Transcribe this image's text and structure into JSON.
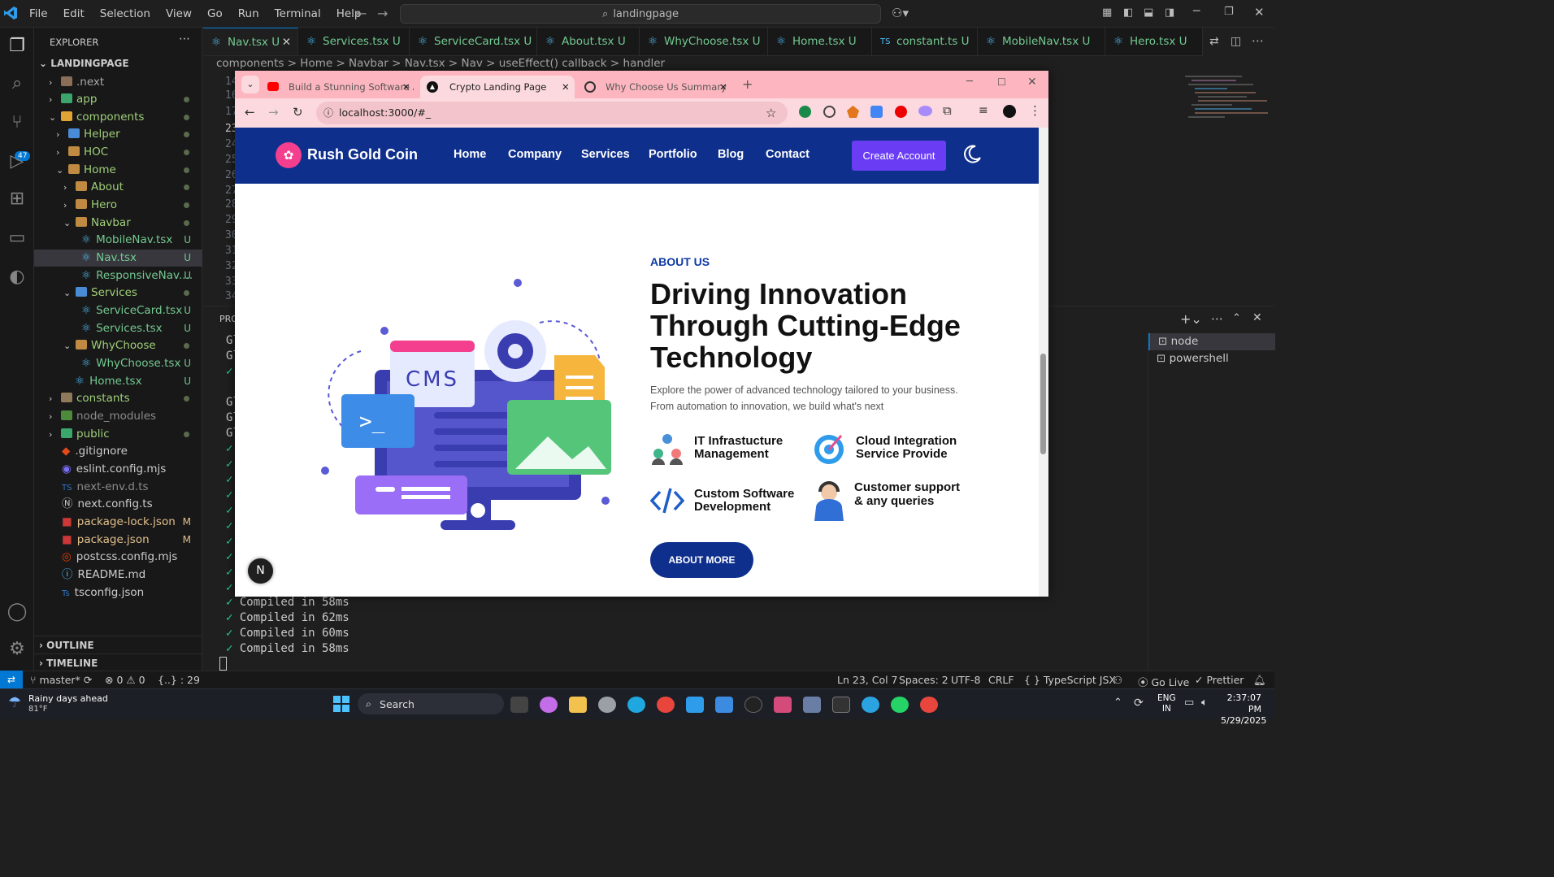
{
  "menu": [
    "File",
    "Edit",
    "Selection",
    "View",
    "Go",
    "Run",
    "Terminal",
    "Help"
  ],
  "search": {
    "label": "landingpage"
  },
  "explorer": {
    "title": "EXPLORER",
    "root": "LANDINGPAGE",
    "items": [
      {
        "label": ".next",
        "status": ""
      },
      {
        "label": "app",
        "status": ""
      },
      {
        "label": "components",
        "status": ""
      },
      {
        "label": "Helper",
        "status": ""
      },
      {
        "label": "HOC",
        "status": ""
      },
      {
        "label": "Home",
        "status": ""
      },
      {
        "label": "About",
        "status": ""
      },
      {
        "label": "Hero",
        "status": ""
      },
      {
        "label": "Navbar",
        "status": ""
      },
      {
        "label": "MobileNav.tsx",
        "status": "U"
      },
      {
        "label": "Nav.tsx",
        "status": "U"
      },
      {
        "label": "ResponsiveNav....",
        "status": "U"
      },
      {
        "label": "Services",
        "status": ""
      },
      {
        "label": "ServiceCard.tsx",
        "status": "U"
      },
      {
        "label": "Services.tsx",
        "status": "U"
      },
      {
        "label": "WhyChoose",
        "status": ""
      },
      {
        "label": "WhyChoose.tsx",
        "status": "U"
      },
      {
        "label": "Home.tsx",
        "status": "U"
      },
      {
        "label": "constants",
        "status": ""
      },
      {
        "label": "node_modules",
        "status": ""
      },
      {
        "label": "public",
        "status": ""
      },
      {
        "label": ".gitignore",
        "status": ""
      },
      {
        "label": "eslint.config.mjs",
        "status": ""
      },
      {
        "label": "next-env.d.ts",
        "status": ""
      },
      {
        "label": "next.config.ts",
        "status": ""
      },
      {
        "label": "package-lock.json",
        "status": "M"
      },
      {
        "label": "package.json",
        "status": "M"
      },
      {
        "label": "postcss.config.mjs",
        "status": ""
      },
      {
        "label": "README.md",
        "status": ""
      },
      {
        "label": "tsconfig.json",
        "status": ""
      }
    ],
    "outline": "OUTLINE",
    "timeline": "TIMELINE"
  },
  "tabs": [
    {
      "label": "Nav.tsx",
      "status": "U"
    },
    {
      "label": "Services.tsx",
      "status": "U"
    },
    {
      "label": "ServiceCard.tsx",
      "status": "U"
    },
    {
      "label": "About.tsx",
      "status": "U"
    },
    {
      "label": "WhyChoose.tsx",
      "status": "U"
    },
    {
      "label": "Home.tsx",
      "status": "U"
    },
    {
      "label": "constant.ts",
      "status": "U"
    },
    {
      "label": "MobileNav.tsx",
      "status": "U"
    },
    {
      "label": "Hero.tsx",
      "status": "U"
    }
  ],
  "breadcrumbs": "components > Home > Navbar > Nav.tsx > Nav > useEffect() callback > handler",
  "gutter": [
    "14",
    "16",
    "17",
    "23",
    "24",
    "25",
    "26",
    "27",
    "28",
    "29",
    "30",
    "31",
    "32",
    "33",
    "34"
  ],
  "terminal": {
    "panel_label": "PRO",
    "lines": [
      "Compiled in 58ms",
      "Compiled in 62ms",
      "Compiled in 60ms",
      "Compiled in 58ms"
    ],
    "prefix": "Gl",
    "shells": [
      "node",
      "powershell"
    ]
  },
  "browser": {
    "tabs": [
      "Build a Stunning Software Agen",
      "Crypto Landing Page",
      "Why Choose Us Summary"
    ],
    "url": "localhost:3000/#_"
  },
  "site": {
    "brand": "Rush Gold Coin",
    "nav": [
      "Home",
      "Company",
      "Services",
      "Portfolio",
      "Blog",
      "Contact"
    ],
    "cta": "Create Account",
    "cms_label": "CMS",
    "about_label": "ABOUT US",
    "headline": "Driving Innovation Through Cutting-Edge Technology",
    "desc": "Explore the power of advanced technology tailored to your business. From automation to innovation, we build what's next",
    "features": [
      "IT Infrastucture Management",
      "Cloud Integration Service Provide",
      "Custom Software Development",
      "Customer support & any queries"
    ],
    "about_more": "ABOUT MORE"
  },
  "status": {
    "branch": "master*",
    "problems": "0",
    "warnings": "0",
    "braces": "{..} : 29",
    "position": "Ln 23, Col 7",
    "spaces": "Spaces: 2",
    "encoding": "UTF-8",
    "eol": "CRLF",
    "language": "TypeScript JSX",
    "golive": "Go Live",
    "prettier": "Prettier"
  },
  "taskbar": {
    "weather": "Rainy days ahead",
    "temp": "81°F",
    "search": "Search",
    "lang1": "ENG",
    "lang2": "IN",
    "time": "2:37:07 PM",
    "date": "5/29/2025"
  },
  "colors": {
    "nav": "#0e2f8c",
    "cta": "#6a3df5",
    "accent": "#0078d4",
    "tabbar": "#fdb6bf"
  }
}
